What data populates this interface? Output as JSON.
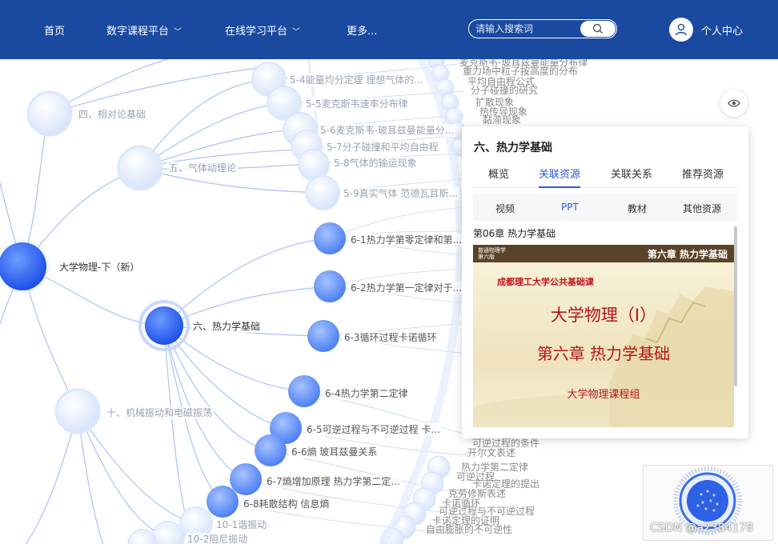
{
  "nav": {
    "home": "首页",
    "digital": "数字课程平台",
    "online": "在线学习平台",
    "more": "更多...",
    "search_placeholder": "请输入搜索词",
    "user": "个人中心"
  },
  "graph": {
    "root": "大学物理-下（新）",
    "chapters": {
      "relativity": "四、相对论基础",
      "gas": "五、气体动理论",
      "thermo": "六、热力学基础",
      "vibration": "十、机械振动和电磁振荡"
    },
    "sections": {
      "s54": "5-4能量均分定理 理想气体的...",
      "s55": "5-5麦克斯韦速率分布律",
      "s56": "5-6麦克斯韦-玻耳兹曼能量分...",
      "s57": "5-7分子碰撞和平均自由程",
      "s58": "5-8气体的输运现象",
      "s59": "5-9真实气体 范德瓦耳斯...",
      "s61": "6-1热力学第零定律和第...",
      "s62": "6-2热力学第一定律对于...",
      "s63": "6-3循环过程卡诺循环",
      "s64": "6-4热力学第二定律",
      "s65": "6-5可逆过程与不可逆过程 卡...",
      "s66": "6-6熵 玻耳兹曼关系",
      "s67": "6-7熵增加原理 热力学第二定...",
      "s68": "6-8耗散结构 信息熵",
      "s101": "10-1谐振动",
      "s102": "10-2阻尼振动"
    },
    "leaf_texts": [
      "麦克斯韦-玻耳兹曼能量分布律",
      "重力场中粒子按高度的分布",
      "平均自由程公式",
      "分子碰撞的研究",
      "扩散现象",
      "热传导现象",
      "黏滞现象",
      "可逆过程的条件",
      "开尔文表述",
      "热力学第二定律",
      "可逆过程",
      "卡诺定理的提出",
      "克劳修斯表述",
      "卡诺循环",
      "可逆过程与不可逆过程",
      "卡诺定理的证明",
      "自由膨胀的不可逆性"
    ]
  },
  "panel": {
    "title": "六、热力学基础",
    "tabs": [
      "概览",
      "关联资源",
      "关联关系",
      "推荐资源"
    ],
    "active_tab": "关联资源",
    "subtabs": [
      "视频",
      "PPT",
      "教材",
      "其他资源"
    ],
    "active_subtab": "PPT",
    "resource_title": "第06章 热力学基础",
    "slide": {
      "tag_line1": "普通物理学",
      "tag_line2": "第六版",
      "chapter": "第六章  热力学基础",
      "school": "成都理工大学公共基础课",
      "title1": "大学物理（Ⅰ）",
      "title2": "第六章  热力学基础",
      "group": "大学物理课程组"
    }
  },
  "watermark": "CSDN @a2384178",
  "colors": {
    "header": "#1a4aa0",
    "accent": "#2a5bd7",
    "node_dark": "#2f63f0",
    "node_light": "#e3ecfc",
    "slide_red": "#b3151a"
  }
}
